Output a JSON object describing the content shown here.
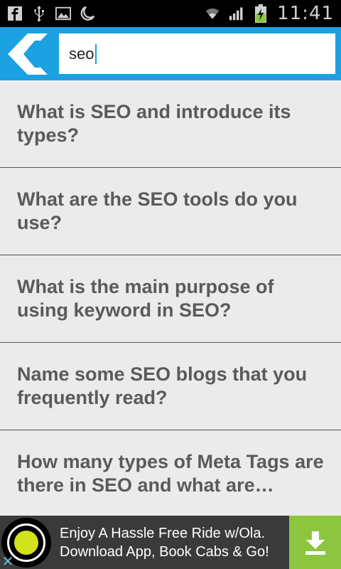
{
  "status_bar": {
    "time": "11:41",
    "icons": [
      "facebook-icon",
      "usb-icon",
      "image-icon",
      "moon-icon",
      "wifi-icon",
      "signal-icon",
      "battery-charging-icon"
    ]
  },
  "search": {
    "value": "seo",
    "back_icon": "back-arrow-icon"
  },
  "results": [
    {
      "text": "What is SEO and introduce its types?"
    },
    {
      "text": "What are the SEO tools do you use?"
    },
    {
      "text": "What is the main purpose of using keyword in SEO?"
    },
    {
      "text": "Name some SEO blogs that you frequently read?"
    },
    {
      "text": "How many types of Meta Tags are there in SEO and what are…"
    }
  ],
  "ad": {
    "line1": "Enjoy A Hassle Free Ride w/Ola.",
    "line2": "Download App, Book Cabs & Go!",
    "close": "✕",
    "colors": {
      "banner": "#3a3a3a",
      "download": "#8cc63f",
      "logo_dot": "#d4e21c"
    }
  },
  "colors": {
    "header": "#1ba1e2",
    "list_bg": "#ebebeb",
    "item_text": "#5a5a5a"
  }
}
